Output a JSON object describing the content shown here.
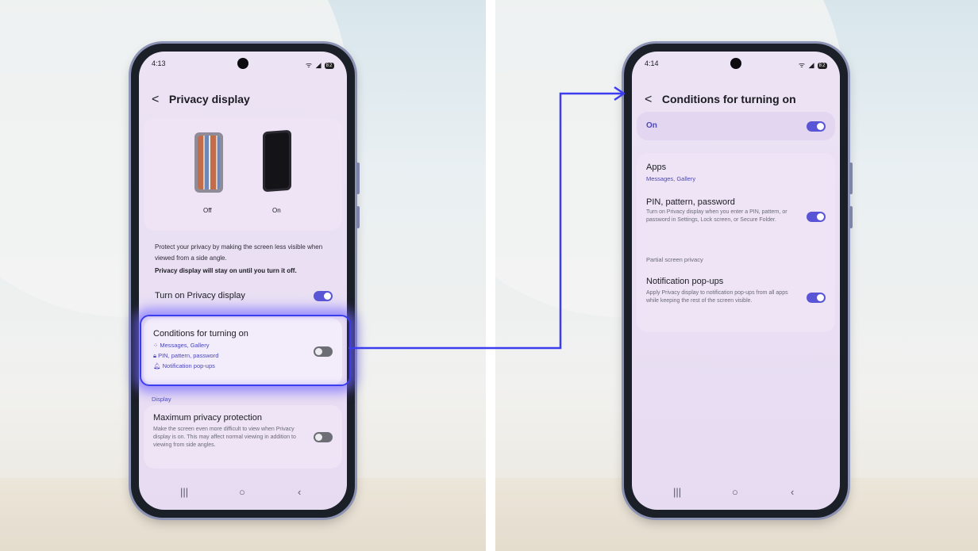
{
  "left_screen": {
    "time": "4:13",
    "battery": "82",
    "title": "Privacy display",
    "preview": {
      "off_label": "Off",
      "on_label": "On"
    },
    "description": "Protect your privacy by making the screen less visible when viewed from a side angle.",
    "note": "Privacy display will stay on until you turn it off.",
    "turn_on_label": "Turn on Privacy display",
    "turn_on_state": "on",
    "conditions": {
      "title": "Conditions for turning on",
      "items": [
        "Messages, Gallery",
        "PIN, pattern, password",
        "Notification pop-ups"
      ],
      "state": "off"
    },
    "display_section": "Display",
    "max_protection": {
      "title": "Maximum privacy protection",
      "description": "Make the screen even more difficult to view when Privacy display is on. This may affect normal viewing in addition to viewing from side angles.",
      "state": "off"
    }
  },
  "right_screen": {
    "time": "4:14",
    "battery": "82",
    "title": "Conditions for turning on",
    "master_label": "On",
    "master_state": "on",
    "apps": {
      "title": "Apps",
      "value": "Messages, Gallery"
    },
    "pin": {
      "title": "PIN, pattern, password",
      "description": "Turn on Privacy display when you enter a PIN, pattern, or password in Settings, Lock screen, or Secure Folder.",
      "state": "on"
    },
    "partial_section": "Partial screen privacy",
    "notif": {
      "title": "Notification pop-ups",
      "description": "Apply Privacy display to notification pop-ups from all apps while keeping the rest of the screen visible.",
      "state": "on"
    }
  },
  "colors": {
    "accent": "#5a55d6",
    "highlight": "#3d3df0"
  }
}
